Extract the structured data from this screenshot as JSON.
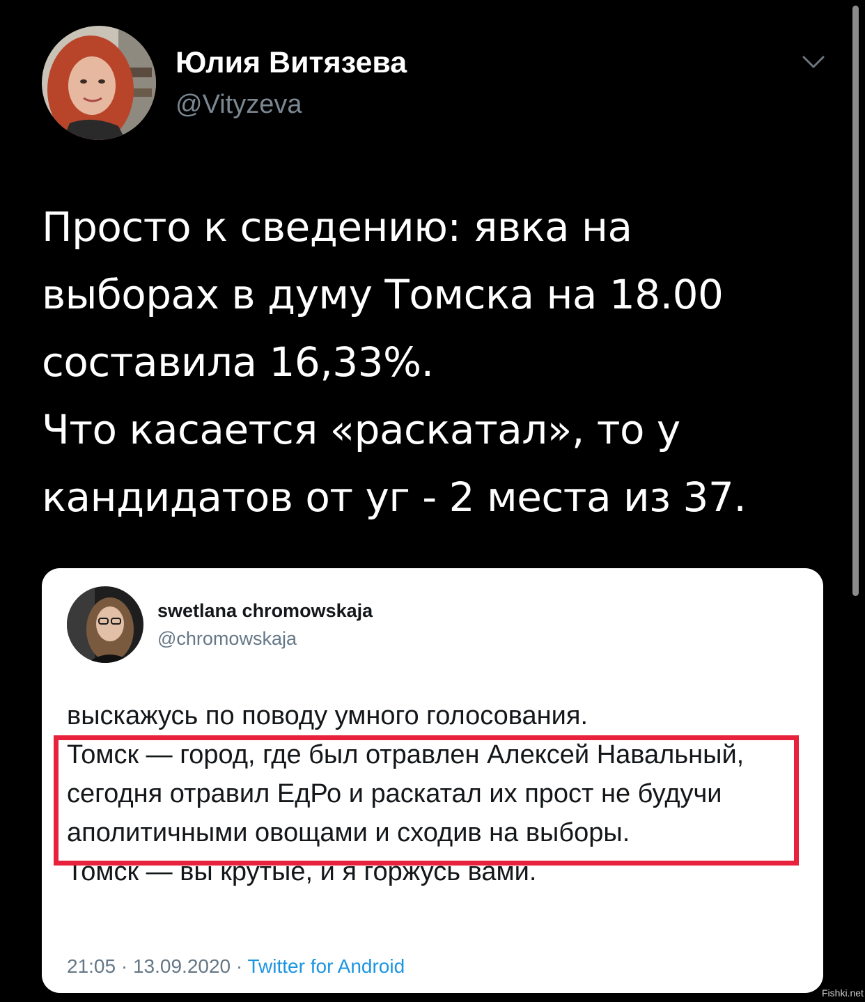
{
  "author": {
    "name": "Юлия Витязева",
    "handle": "@Vityzeva"
  },
  "tweet": {
    "lines": [
      "Просто к сведению: явка на",
      "выборах в думу Томска на 18.00",
      "составила 16,33%.",
      "Что касается «раскатал», то у",
      "кандидатов от уг - 2 места из 37."
    ]
  },
  "quoted_tweet": {
    "name": "swetlana chromowskaja",
    "handle": "@chromowskaja",
    "lines": [
      "выскажусь по поводу умного голосования.",
      "Томск — город, где был отравлен Алексей Навальный,",
      "сегодня отравил ЕдРо и раскатал их прост не будучи",
      "аполитичными овощами и сходив на выборы.",
      "Томск — вы крутые, и я горжусь вами."
    ],
    "time": "21:05",
    "separator": "·",
    "date": "13.09.2020",
    "source": "Twitter for Android"
  },
  "watermark": "Fishki.net",
  "icons": {
    "menu": "chevron-down-icon"
  },
  "colors": {
    "background": "#000000",
    "handle_gray": "#7b8791",
    "highlight_red": "#e8213c",
    "link_blue": "#1b95e0"
  }
}
